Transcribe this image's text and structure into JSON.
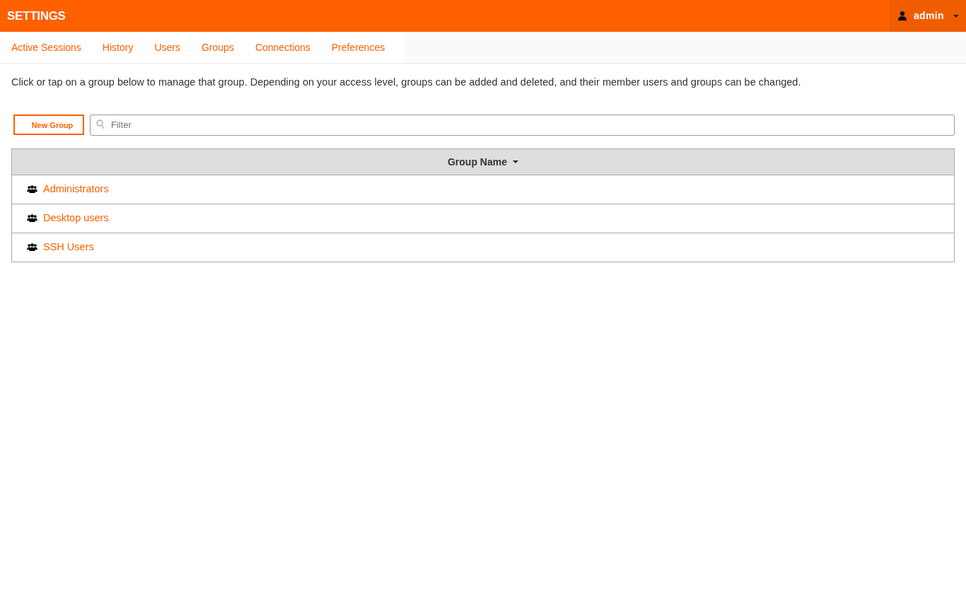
{
  "header": {
    "title": "SETTINGS",
    "user_menu": {
      "username": "admin"
    }
  },
  "tabs": [
    {
      "label": "Active Sessions"
    },
    {
      "label": "History"
    },
    {
      "label": "Users"
    },
    {
      "label": "Groups"
    },
    {
      "label": "Connections"
    },
    {
      "label": "Preferences"
    }
  ],
  "description": "Click or tap on a group below to manage that group. Depending on your access level, groups can be added and deleted, and their member users and groups can be changed.",
  "toolbar": {
    "new_button": "New Group",
    "filter": {
      "placeholder": "Filter"
    }
  },
  "table": {
    "columns": [
      "Group Name"
    ],
    "rows": [
      {
        "name": "Administrators"
      },
      {
        "name": "Desktop users"
      },
      {
        "name": "SSH Users"
      }
    ]
  }
}
